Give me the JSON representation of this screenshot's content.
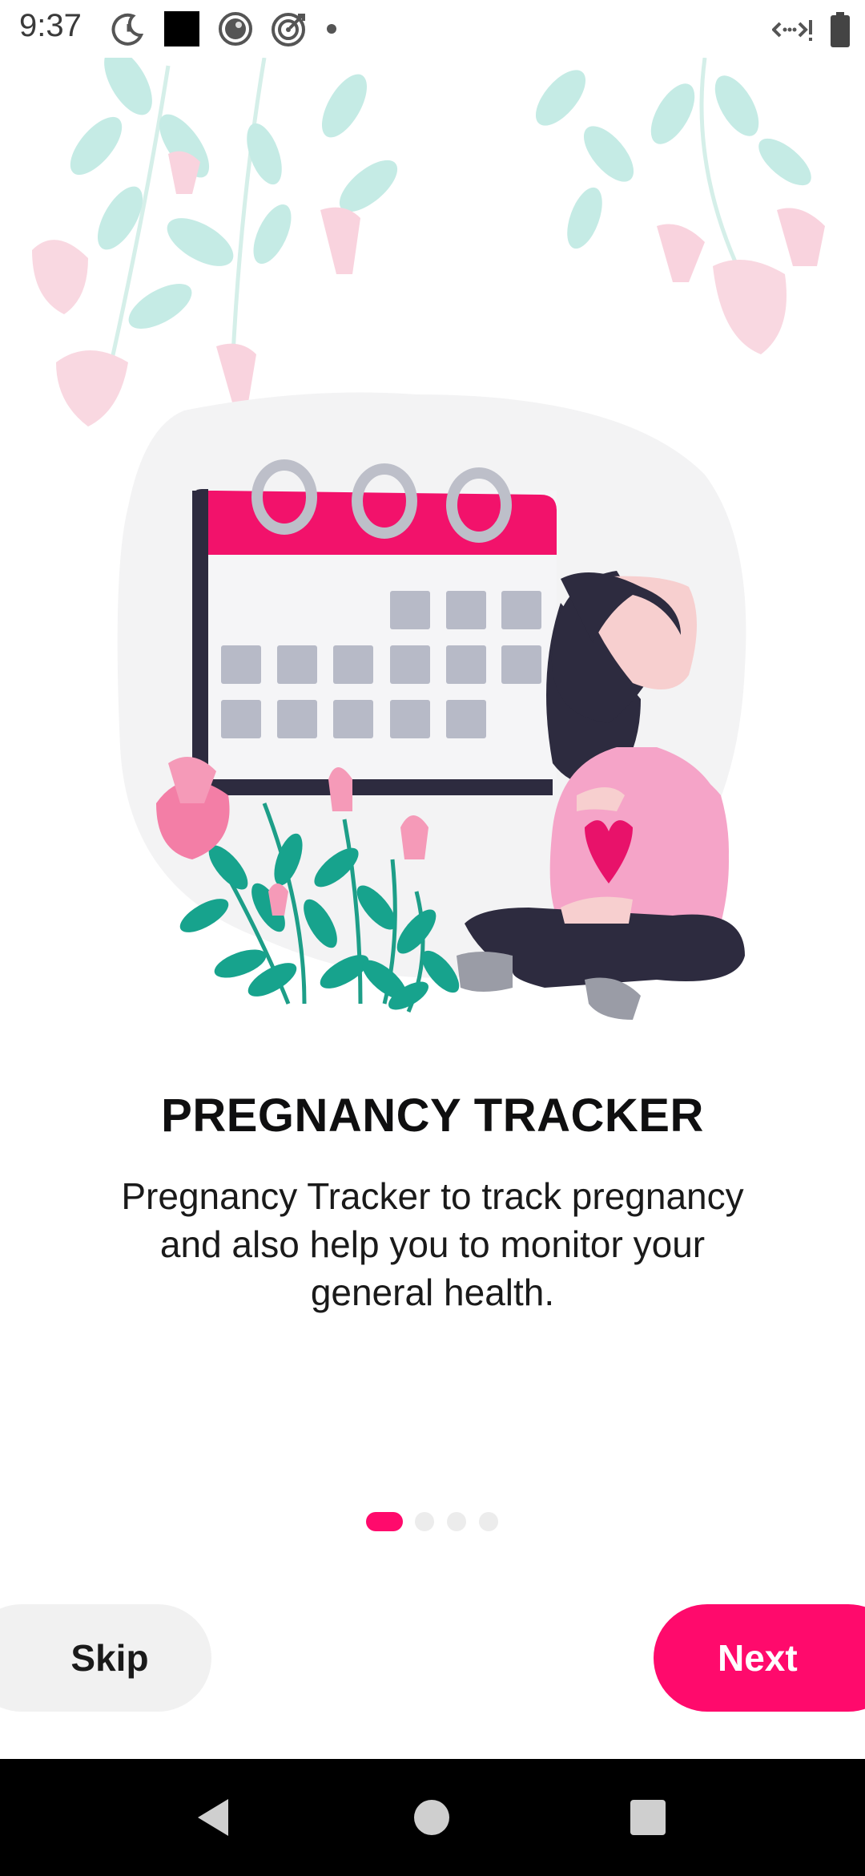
{
  "status_bar": {
    "time": "9:37",
    "left_icons": [
      "moon-clock-icon",
      "black-square-icon",
      "record-circle-icon",
      "target-icon",
      "dot-icon"
    ],
    "right_icons": [
      "data-arrows-icon",
      "battery-icon"
    ]
  },
  "onboarding": {
    "title": "PREGNANCY TRACKER",
    "description": "Pregnancy Tracker to track pregnancy and also help you to monitor your general health.",
    "page_indicator": {
      "total": 4,
      "current": 1
    }
  },
  "actions": {
    "skip_label": "Skip",
    "next_label": "Next"
  },
  "navigation_bar": {
    "buttons": [
      "back-icon",
      "home-icon",
      "recents-icon"
    ]
  },
  "colors": {
    "accent": "#ff0a6c",
    "skip_bg": "#f1f1f1",
    "leaf": "#b7e6e1",
    "petal": "#f8d5df",
    "teal": "#17a38d"
  }
}
